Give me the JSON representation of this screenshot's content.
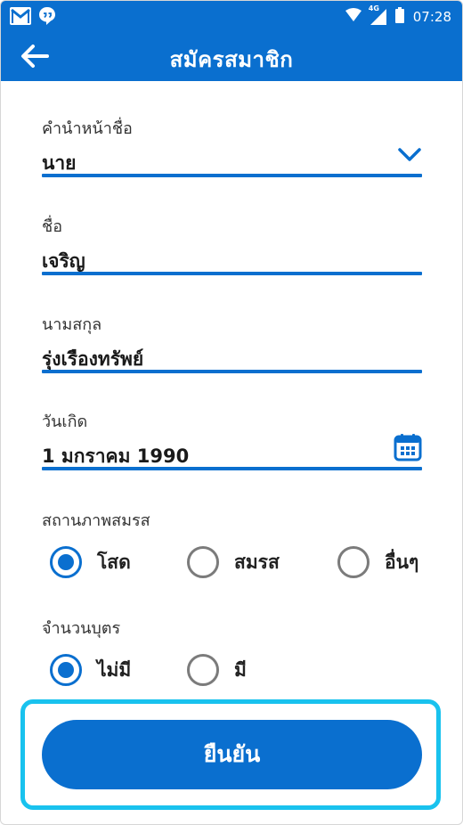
{
  "status_bar": {
    "network": "4G",
    "time": "07:28"
  },
  "header": {
    "title": "สมัครสมาชิก"
  },
  "form": {
    "prefix": {
      "label": "คำนำหน้าชื่อ",
      "value": "นาย"
    },
    "first_name": {
      "label": "ชื่อ",
      "value": "เจริญ"
    },
    "last_name": {
      "label": "นามสกุล",
      "value": "รุ่งเรืองทรัพย์"
    },
    "birthdate": {
      "label": "วันเกิด",
      "value": "1 มกราคม 1990"
    },
    "marital_status": {
      "label": "สถานภาพสมรส",
      "options": [
        "โสด",
        "สมรส",
        "อื่นๆ"
      ],
      "selected": "โสด"
    },
    "children": {
      "label": "จำนวนบุตร",
      "options": [
        "ไม่มี",
        "มี"
      ],
      "selected": "ไม่มี"
    }
  },
  "confirm_label": "ยืนยัน",
  "colors": {
    "primary": "#0a6fcf",
    "highlight": "#19c2ee"
  },
  "icons": [
    "gmail-icon",
    "chat-icon",
    "wifi-icon",
    "signal-icon",
    "battery-icon",
    "back-arrow-icon",
    "chevron-down-icon",
    "calendar-icon"
  ]
}
